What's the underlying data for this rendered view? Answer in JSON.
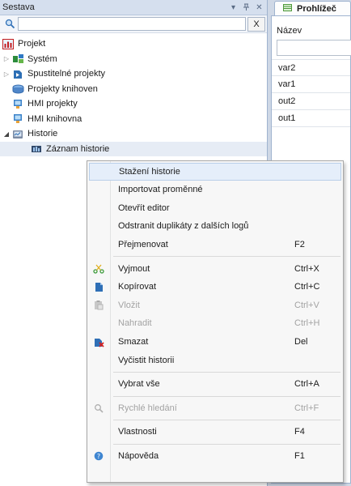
{
  "left_panel": {
    "title": "Sestava",
    "pin_glyph": "▾ ⊥",
    "close_glyph": "✕",
    "search": {
      "value": "",
      "placeholder": "",
      "clear_label": "X"
    },
    "tree": [
      {
        "label": "Projekt",
        "icon": "project-icon",
        "arrow": ""
      },
      {
        "label": "Systém",
        "icon": "system-icon",
        "arrow": "▷"
      },
      {
        "label": "Spustitelné projekty",
        "icon": "runnable-projects-icon",
        "arrow": "▷"
      },
      {
        "label": "Projekty knihoven",
        "icon": "library-projects-icon",
        "arrow": ""
      },
      {
        "label": "HMI projekty",
        "icon": "hmi-projects-icon",
        "arrow": ""
      },
      {
        "label": "HMI knihovna",
        "icon": "hmi-library-icon",
        "arrow": ""
      },
      {
        "label": "Historie",
        "icon": "history-icon",
        "arrow": "◢"
      },
      {
        "label": "Záznam historie",
        "icon": "history-record-icon",
        "arrow": ""
      }
    ]
  },
  "right_panel": {
    "tab_title": "Prohlížeč",
    "column_header": "Název",
    "filter_value": "",
    "variables": [
      "var2",
      "var1",
      "out2",
      "out1"
    ]
  },
  "context_menu": {
    "items": [
      {
        "label": "Stažení historie",
        "shortcut": "",
        "icon": "",
        "disabled": false,
        "highlighted": true
      },
      {
        "label": "Importovat proměnné",
        "shortcut": "",
        "icon": "",
        "disabled": false
      },
      {
        "label": "Otevřít editor",
        "shortcut": "",
        "icon": "",
        "disabled": false
      },
      {
        "label": "Odstranit duplikáty z dalších logů",
        "shortcut": "",
        "icon": "",
        "disabled": false
      },
      {
        "label": "Přejmenovat",
        "shortcut": "F2",
        "icon": "",
        "disabled": false
      },
      {
        "label": "Vyjmout",
        "shortcut": "Ctrl+X",
        "icon": "cut-icon",
        "disabled": false
      },
      {
        "label": "Kopírovat",
        "shortcut": "Ctrl+C",
        "icon": "copy-icon",
        "disabled": false
      },
      {
        "label": "Vložit",
        "shortcut": "Ctrl+V",
        "icon": "paste-icon",
        "disabled": true
      },
      {
        "label": "Nahradit",
        "shortcut": "Ctrl+H",
        "icon": "",
        "disabled": true
      },
      {
        "label": "Smazat",
        "shortcut": "Del",
        "icon": "delete-icon",
        "disabled": false
      },
      {
        "label": "Vyčistit historii",
        "shortcut": "",
        "icon": "",
        "disabled": false
      },
      {
        "label": "Vybrat vše",
        "shortcut": "Ctrl+A",
        "icon": "",
        "disabled": false
      },
      {
        "label": "Rychlé hledání",
        "shortcut": "Ctrl+F",
        "icon": "quick-search-icon",
        "disabled": true
      },
      {
        "label": "Vlastnosti",
        "shortcut": "F4",
        "icon": "",
        "disabled": false
      },
      {
        "label": "Nápověda",
        "shortcut": "F1",
        "icon": "help-icon",
        "disabled": false
      }
    ]
  },
  "colors": {
    "panel_header": "#d5dfee",
    "menu_highlight": "#e5eefa",
    "disabled_text": "#a3a3a3"
  }
}
